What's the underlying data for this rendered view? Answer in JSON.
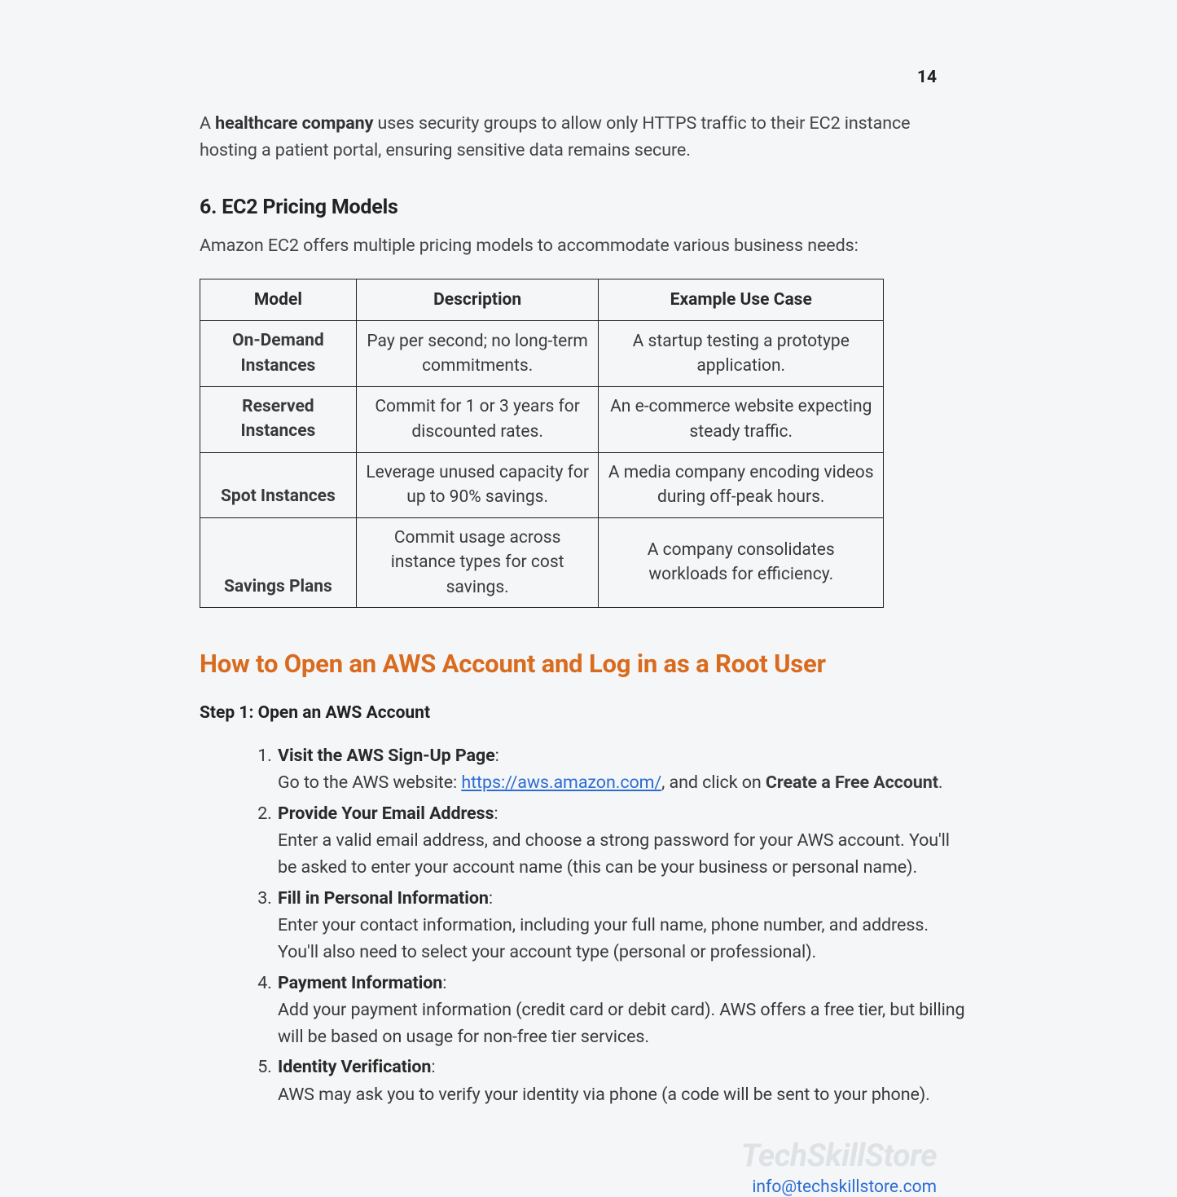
{
  "page_number": "14",
  "intro_before": "A ",
  "intro_bold": "healthcare company",
  "intro_after": " uses security groups to allow only HTTPS traffic to their EC2 instance hosting a patient portal, ensuring sensitive data remains secure.",
  "section6": {
    "heading": "6. EC2 Pricing Models",
    "lead": "Amazon EC2 offers multiple pricing models to accommodate various business needs:",
    "headers": [
      "Model",
      "Description",
      "Example Use Case"
    ],
    "rows": [
      {
        "model": "On-Demand Instances",
        "desc": "Pay per second; no long-term commitments.",
        "use": "A startup testing a prototype application."
      },
      {
        "model": "Reserved Instances",
        "desc": "Commit for 1 or 3 years for discounted rates.",
        "use": "An e-commerce website expecting steady traffic."
      },
      {
        "model": "Spot Instances",
        "desc": "Leverage unused capacity for up to 90% savings.",
        "use": "A media company encoding videos during off-peak hours."
      },
      {
        "model": "Savings Plans",
        "desc": "Commit usage across instance types for cost savings.",
        "use": "A company consolidates workloads for efficiency."
      }
    ]
  },
  "howto": {
    "heading": "How to Open an AWS Account and Log in as a Root User",
    "step_title": "Step 1: Open an AWS Account",
    "items": [
      {
        "title": "Visit the AWS Sign-Up Page",
        "body_before": "Go to the AWS website: ",
        "link_text": "https://aws.amazon.com/",
        "body_mid": ", and click on ",
        "body_bold": "Create a Free Account",
        "body_after": "."
      },
      {
        "title": "Provide Your Email Address",
        "body": "Enter a valid email address, and choose a strong password for your AWS account. You'll be asked to enter your account name (this can be your business or personal name)."
      },
      {
        "title": "Fill in Personal Information",
        "body": "Enter your contact information, including your full name, phone number, and address. You'll also need to select your account type (personal or professional)."
      },
      {
        "title": "Payment Information",
        "body": "Add your payment information (credit card or debit card). AWS offers a free tier, but billing will be based on usage for non-free tier services."
      },
      {
        "title": "Identity Verification",
        "body": "AWS may ask you to verify your identity via phone (a code will be sent to your phone)."
      }
    ]
  },
  "footer": {
    "watermark": "TechSkillStore",
    "email": "info@techskillstore.com"
  }
}
